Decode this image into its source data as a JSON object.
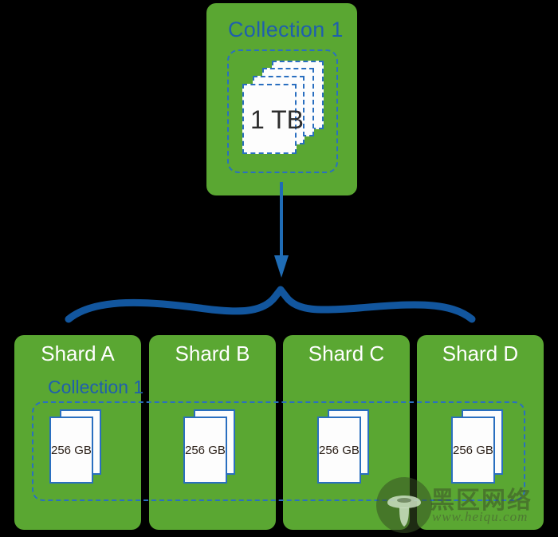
{
  "diagram": {
    "type": "sharding-diagram",
    "background_color": "#000000",
    "panel_color": "#5aa732",
    "accent_blue": "#1f5fad",
    "dashed_blue": "#2a6fc0",
    "title_white": "#ffffff"
  },
  "source": {
    "title": "Collection 1",
    "boundary_label": "Collection 1",
    "document_label": "1 TB",
    "document_count": 4
  },
  "shards": [
    {
      "title": "Shard A",
      "document_label": "256 GB",
      "document_count": 2
    },
    {
      "title": "Shard B",
      "document_label": "256 GB",
      "document_count": 2
    },
    {
      "title": "Shard C",
      "document_label": "256 GB",
      "document_count": 2
    },
    {
      "title": "Shard D",
      "document_label": "256 GB",
      "document_count": 2
    }
  ],
  "shard_collection_label": "Collection 1",
  "connector": {
    "arrow_direction": "down",
    "arrow_color": "#1f6cb5",
    "brace_color": "#12569e"
  },
  "watermark": {
    "text": "黑区网络",
    "url": "www.heiqu.com",
    "icon": "mushroom-icon"
  }
}
